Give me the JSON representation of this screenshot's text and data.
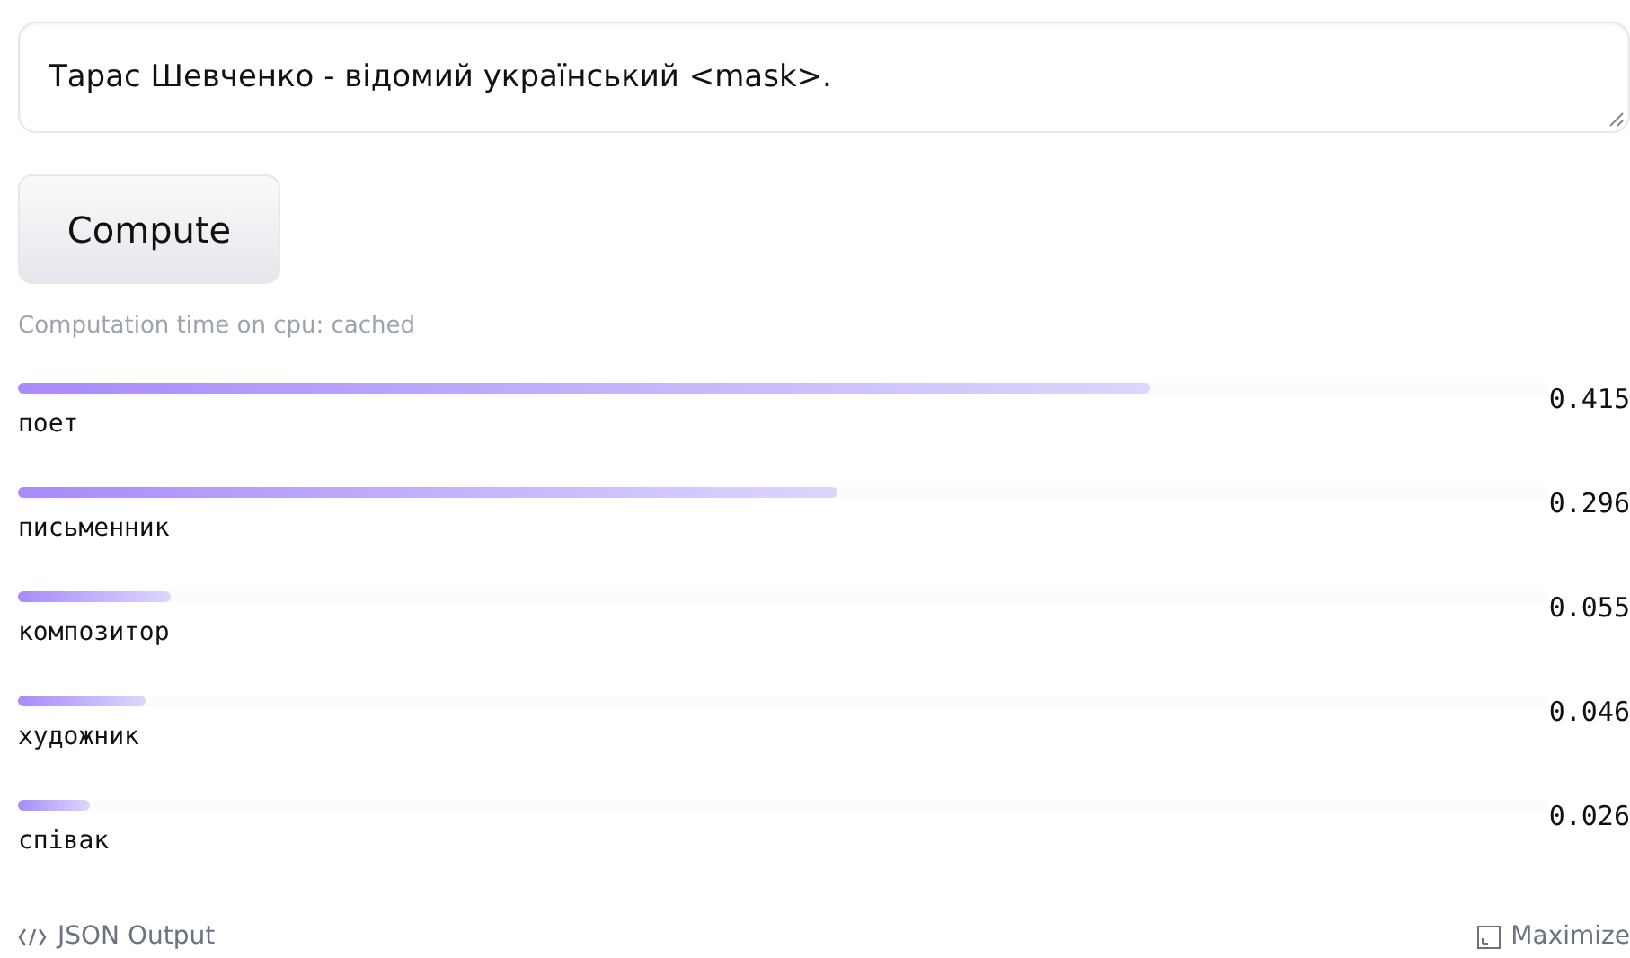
{
  "input": {
    "value": "Тарас Шевченко - відомий український <mask>."
  },
  "compute_button": {
    "label": "Compute"
  },
  "computation_time": "Computation time on cpu: cached",
  "results": [
    {
      "label": "поет",
      "score": "0.415",
      "level": 0.74
    },
    {
      "label": "письменник",
      "score": "0.296",
      "level": 0.535
    },
    {
      "label": "композитор",
      "score": "0.055",
      "level": 0.1
    },
    {
      "label": "художник",
      "score": "0.046",
      "level": 0.083
    },
    {
      "label": "співак",
      "score": "0.026",
      "level": 0.047
    }
  ],
  "footer": {
    "json_output": "JSON Output",
    "maximize": "Maximize"
  }
}
